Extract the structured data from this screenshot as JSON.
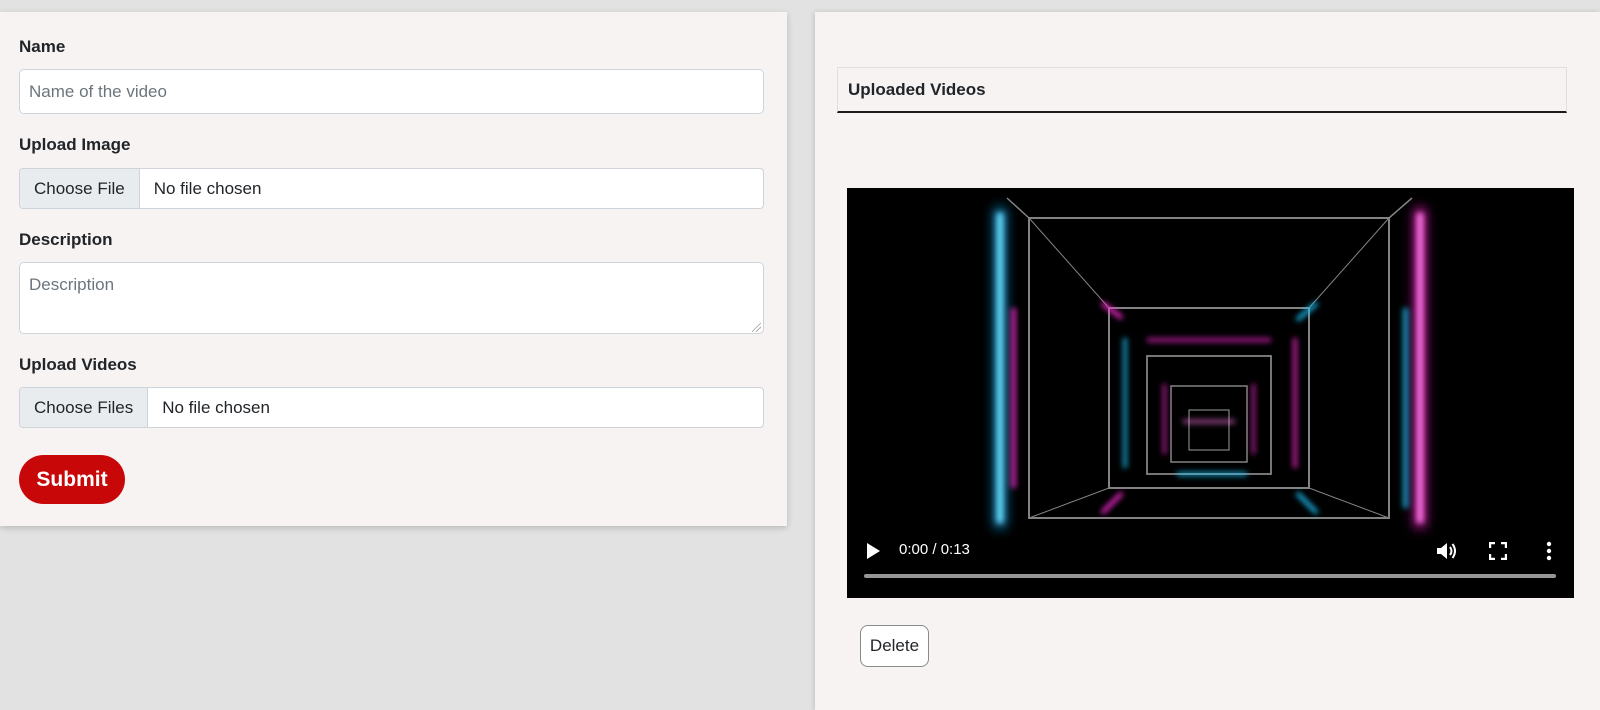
{
  "form": {
    "name_label": "Name",
    "name_placeholder": "Name of the video",
    "image_label": "Upload Image",
    "image_button": "Choose File",
    "image_status": "No file chosen",
    "description_label": "Description",
    "description_placeholder": "Description",
    "videos_label": "Upload Videos",
    "videos_button": "Choose Files",
    "videos_status": "No file chosen",
    "submit_label": "Submit"
  },
  "uploaded": {
    "title": "Uploaded Videos",
    "video": {
      "time": "0:00 / 0:13",
      "progress": 0,
      "play_icon": "play-icon",
      "volume_icon": "volume-icon",
      "fullscreen_icon": "fullscreen-icon",
      "menu_icon": "more-vertical-icon"
    },
    "delete_label": "Delete"
  },
  "colors": {
    "submit": "#c80808",
    "panel_bg": "#f7f3f2",
    "page_bg": "#e2e2e2",
    "neon_cyan": "#1ec8ff",
    "neon_magenta": "#ff2bd6"
  }
}
